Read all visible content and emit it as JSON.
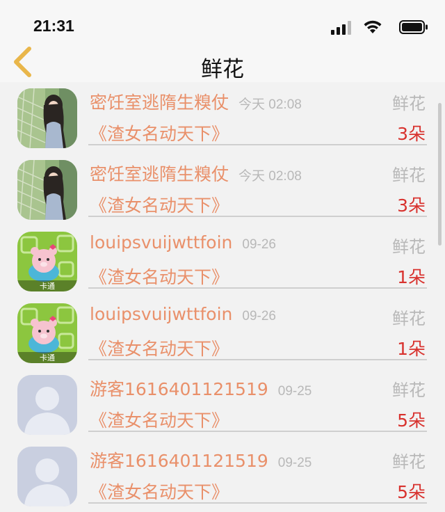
{
  "status_bar": {
    "time": "21:31"
  },
  "nav": {
    "title": "鲜花"
  },
  "records": [
    {
      "name": "密饪室逃隋生糗仗",
      "date": "今天 02:08",
      "type": "鲜花",
      "book": "《渣女名动天下》",
      "count": "3朵",
      "avatar": "photo"
    },
    {
      "name": "密饪室逃隋生糗仗",
      "date": "今天 02:08",
      "type": "鲜花",
      "book": "《渣女名动天下》",
      "count": "3朵",
      "avatar": "photo"
    },
    {
      "name": "louipsvuijwttfoin",
      "date": "09-26",
      "type": "鲜花",
      "book": "《渣女名动天下》",
      "count": "1朵",
      "avatar": "cartoon"
    },
    {
      "name": "louipsvuijwttfoin",
      "date": "09-26",
      "type": "鲜花",
      "book": "《渣女名动天下》",
      "count": "1朵",
      "avatar": "cartoon"
    },
    {
      "name": "游客1616401121519",
      "date": "09-25",
      "type": "鲜花",
      "book": "《渣女名动天下》",
      "count": "5朵",
      "avatar": "default"
    },
    {
      "name": "游客1616401121519",
      "date": "09-25",
      "type": "鲜花",
      "book": "《渣女名动天下》",
      "count": "5朵",
      "avatar": "default"
    }
  ],
  "avatar_badge": "卡通",
  "colors": {
    "accent": "#e9906a",
    "count": "#d8322e",
    "muted": "#b8b8b8",
    "back_arrow": "#e9b64a"
  }
}
